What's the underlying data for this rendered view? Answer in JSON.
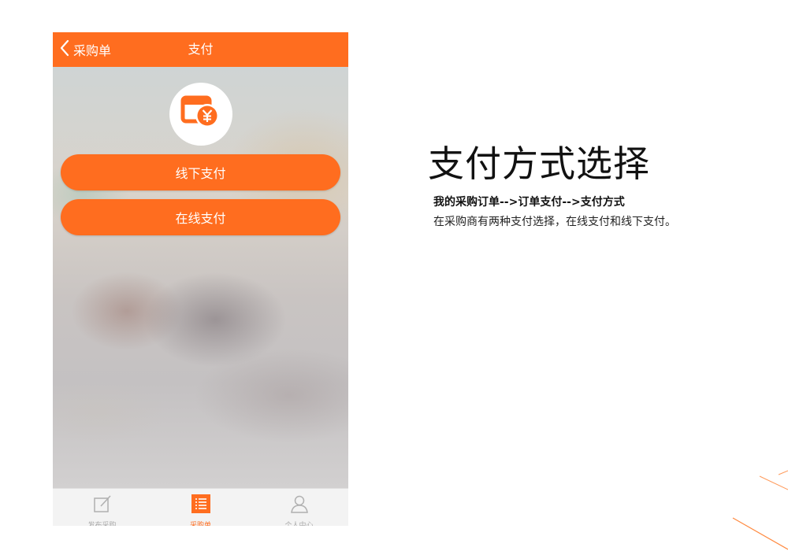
{
  "phone": {
    "topbar": {
      "back_label": "采购单",
      "title": "支付"
    },
    "buttons": {
      "offline": "线下支付",
      "online": "在线支付"
    },
    "tabbar": [
      {
        "label": "发布采购",
        "icon": "edit-icon",
        "active": false
      },
      {
        "label": "采购单",
        "icon": "list-icon",
        "active": true
      },
      {
        "label": "个人中心",
        "icon": "user-icon",
        "active": false
      }
    ]
  },
  "description": {
    "heading": "支付方式选择",
    "flow": "我的采购订单-->订单支付-->支付方式",
    "text": "在采购商有两种支付选择，在线支付和线下支付。"
  },
  "colors": {
    "accent": "#ff6d1f",
    "tab_inactive": "#aaaaaa"
  }
}
